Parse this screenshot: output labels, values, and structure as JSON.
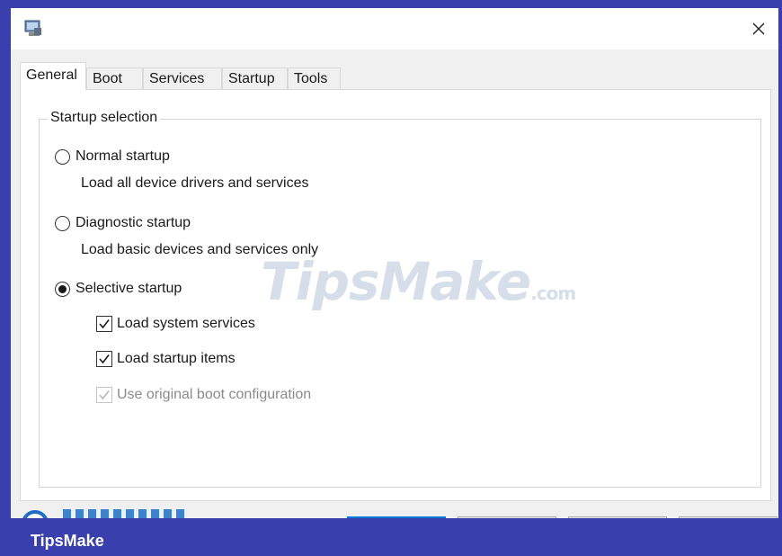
{
  "window": {
    "icon": "msconfig-computer-icon",
    "close_icon": "close-icon"
  },
  "tabs": [
    {
      "label": "General",
      "active": true
    },
    {
      "label": "Boot",
      "active": false
    },
    {
      "label": "Services",
      "active": false
    },
    {
      "label": "Startup",
      "active": false
    },
    {
      "label": "Tools",
      "active": false
    }
  ],
  "startup_selection": {
    "legend": "Startup selection",
    "options": [
      {
        "label": "Normal startup",
        "description": "Load all device drivers and services",
        "selected": false
      },
      {
        "label": "Diagnostic startup",
        "description": "Load basic devices and services only",
        "selected": false
      },
      {
        "label": "Selective startup",
        "selected": true
      }
    ],
    "selective_options": [
      {
        "label": "Load system services",
        "checked": true,
        "enabled": true
      },
      {
        "label": "Load startup items",
        "checked": true,
        "enabled": true
      },
      {
        "label": "Use original boot configuration",
        "checked": true,
        "enabled": false
      }
    ]
  },
  "watermark": {
    "main": "TipsMake",
    "suffix": ".com"
  },
  "footer": {
    "brand": "TipsMake"
  },
  "colors": {
    "accent": "#0078d7",
    "footer_bg": "#3a3fae"
  }
}
